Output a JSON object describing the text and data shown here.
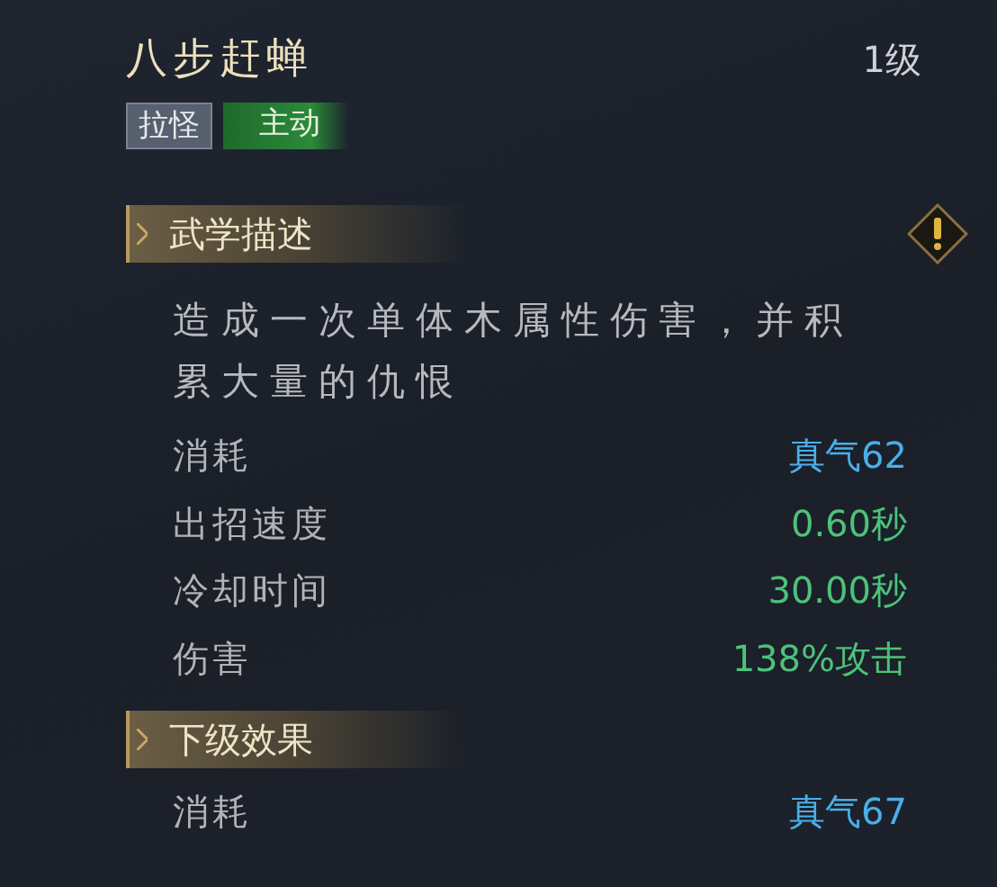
{
  "skill": {
    "name": "八步赶蝉",
    "level": "1级"
  },
  "tags": [
    {
      "label": "拉怪",
      "kind": "plain"
    },
    {
      "label": "主动",
      "kind": "active"
    }
  ],
  "sections": [
    {
      "title": "武学描述",
      "hint_icon": true,
      "description": "造成一次单体木属性伤害，并积累大量的仇恨",
      "stats": [
        {
          "label": "消耗",
          "value": "真气62",
          "color": "#4aaee8"
        },
        {
          "label": "出招速度",
          "value": "0.60秒",
          "color": "#4cc27a"
        },
        {
          "label": "冷却时间",
          "value": "30.00秒",
          "color": "#4cc27a"
        },
        {
          "label": "伤害",
          "value": "138%攻击",
          "color": "#4cc27a"
        }
      ]
    },
    {
      "title": "下级效果",
      "hint_icon": false,
      "stats": [
        {
          "label": "消耗",
          "value": "真气67",
          "color": "#4aaee8"
        }
      ]
    }
  ]
}
